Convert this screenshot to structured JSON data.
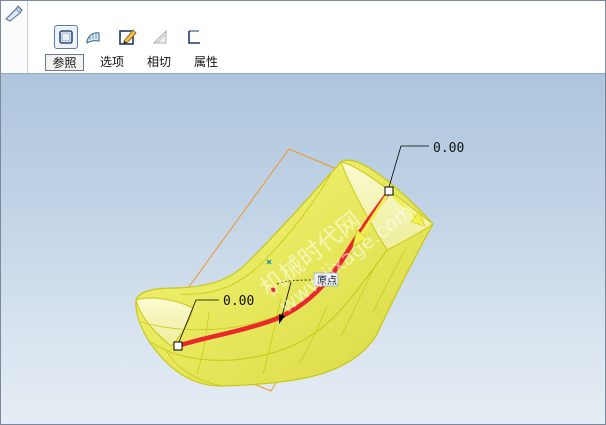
{
  "toolbar": {
    "icons": [
      "sweep-surface-icon",
      "sweep-solid-icon",
      "edit-section-icon",
      "thicken-icon",
      "section-icon"
    ]
  },
  "tabs": [
    {
      "label": "参照",
      "active": true
    },
    {
      "label": "选项",
      "active": false
    },
    {
      "label": "相切",
      "active": false
    },
    {
      "label": "属性",
      "active": false
    }
  ],
  "viewport": {
    "dim_top": "0.00",
    "dim_bottom": "0.00",
    "origin_label": "原点",
    "watermark_cn": "机械时代网",
    "watermark_url": "www.jixage.com"
  },
  "colors": {
    "surface": "#eded6a",
    "surface_edge": "#c8c812",
    "trajectory": "#e8282c",
    "sketch_plane": "#f0962a",
    "direction_arrow": "#f0f050",
    "background_top": "#aec5dd",
    "background_bottom": "#e6edf4"
  }
}
